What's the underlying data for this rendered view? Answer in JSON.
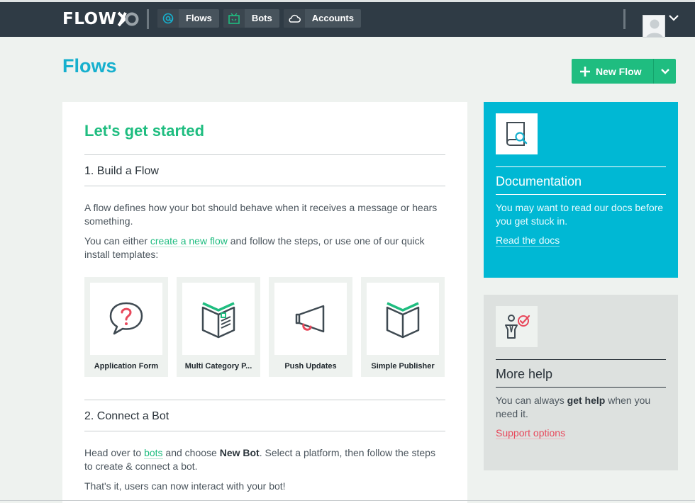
{
  "nav": {
    "brand": "FLOW",
    "items": [
      {
        "label": "Flows",
        "icon": "at-icon"
      },
      {
        "label": "Bots",
        "icon": "bot-icon"
      },
      {
        "label": "Accounts",
        "icon": "cloud-icon"
      }
    ]
  },
  "page": {
    "title": "Flows",
    "new_flow_label": "New Flow"
  },
  "main": {
    "heading": "Let's get started",
    "step1_title": "1. Build a Flow",
    "step1_para1": "A flow defines how your bot should behave when it receives a message or hears something.",
    "step1_para2_before": "You can either ",
    "step1_para2_link": "create a new flow",
    "step1_para2_after": " and follow the steps, or use one of our quick install templates:",
    "templates": [
      {
        "name": "Application Form",
        "icon": "question-bubble-icon"
      },
      {
        "name": "Multi Category P...",
        "icon": "open-book-list-icon"
      },
      {
        "name": "Push Updates",
        "icon": "megaphone-icon"
      },
      {
        "name": "Simple Publisher",
        "icon": "open-book-icon"
      }
    ],
    "step2_title": "2. Connect a Bot",
    "step2_para1_before": "Head over to ",
    "step2_para1_link": "bots",
    "step2_para1_mid": " and choose ",
    "step2_para1_bold": "New Bot",
    "step2_para1_after": ". Select a platform, then follow the steps to create & connect a bot.",
    "step2_para2": "That's it, users can now interact with your bot!"
  },
  "docs": {
    "title": "Documentation",
    "text": "You may want to read our docs before you get stuck in.",
    "link": "Read the docs"
  },
  "help": {
    "title": "More help",
    "text_before": "You can always ",
    "text_bold": "get help",
    "text_after": " when you need it.",
    "link": "Support options"
  },
  "colors": {
    "accent_green": "#1fbd80",
    "accent_cyan": "#16b0ce",
    "nav_bg": "#2f3b45",
    "support_link": "#e8485b"
  }
}
